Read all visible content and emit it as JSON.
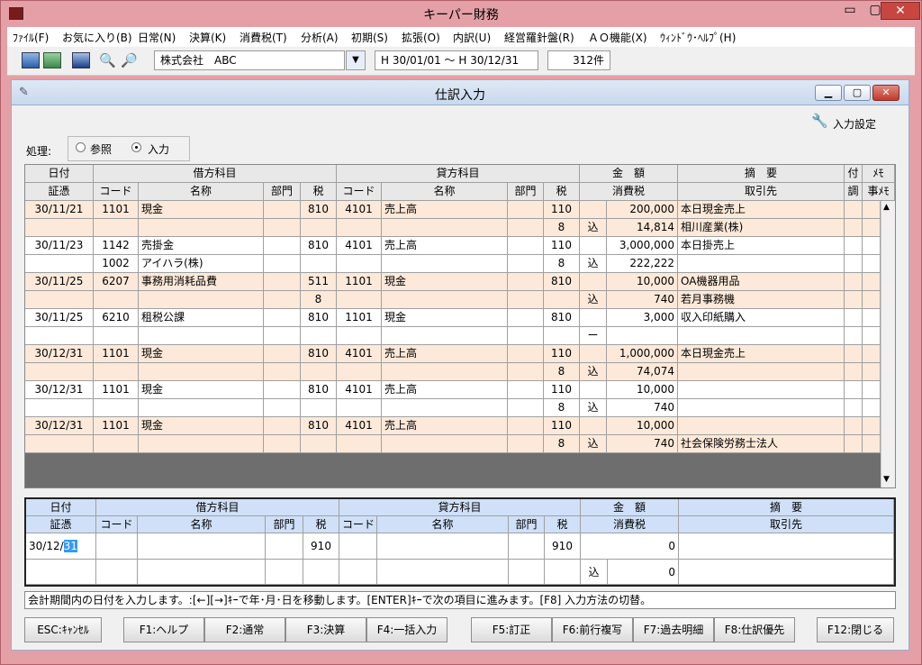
{
  "app": {
    "title": "キーパー財務",
    "minimize": "▭",
    "maximize": "▢",
    "close": "✕"
  },
  "menu": [
    "ﾌｧｲﾙ(F)",
    "お気に入り(B)",
    "日常(N)",
    "決算(K)",
    "消費税(T)",
    "分析(A)",
    "初期(S)",
    "拡張(O)",
    "内訳(U)",
    "経営羅針盤(R)",
    "ＡＯ機能(X)",
    "ｳｨﾝﾄﾞｳ･ﾍﾙﾌﾟ(H)"
  ],
  "toolbar": {
    "company": "株式会社　ABC",
    "period": "H 30/01/01 〜 H 30/12/31",
    "count": "312件"
  },
  "window": {
    "title": "仕訳入力",
    "settings_label": "入力設定"
  },
  "mode": {
    "label": "処理:",
    "ref": "参照",
    "input": "入力"
  },
  "headers": {
    "date": "日付",
    "voucher": "証憑",
    "debit": "借方科目",
    "credit": "貸方科目",
    "code": "コード",
    "name": "名称",
    "dept": "部門",
    "tax": "税",
    "amount": "金　額",
    "ctax": "消費税",
    "desc": "摘　要",
    "partner": "取引先",
    "fu": "付",
    "memo": "ﾒﾓ",
    "chou": "調",
    "jimemo": "事ﾒﾓ"
  },
  "rows": [
    {
      "date": "30/11/21",
      "dcode": "1101",
      "dname": "現金",
      "ddept": "",
      "dtax": "810",
      "ccode": "4101",
      "cname": "売上高",
      "cdept": "",
      "ctax": "110",
      "kom": "",
      "amount": "200,000",
      "desc": "本日現金売上",
      "band": 1
    },
    {
      "date": "",
      "dcode": "",
      "dname": "",
      "ddept": "",
      "dtax": "",
      "ccode": "",
      "cname": "",
      "cdept": "",
      "ctax": "8",
      "kom": "込",
      "amount": "14,814",
      "desc": "相川産業(株)",
      "band": 1
    },
    {
      "date": "30/11/23",
      "dcode": "1142",
      "dname": "売掛金",
      "ddept": "",
      "dtax": "810",
      "ccode": "4101",
      "cname": "売上高",
      "cdept": "",
      "ctax": "110",
      "kom": "",
      "amount": "3,000,000",
      "desc": "本日掛売上",
      "band": 0
    },
    {
      "date": "",
      "dcode": "1002",
      "dname": "アイハラ(株)",
      "ddept": "",
      "dtax": "",
      "ccode": "",
      "cname": "",
      "cdept": "",
      "ctax": "8",
      "kom": "込",
      "amount": "222,222",
      "desc": "",
      "band": 0
    },
    {
      "date": "30/11/25",
      "dcode": "6207",
      "dname": "事務用消耗品費",
      "ddept": "",
      "dtax": "511",
      "ccode": "1101",
      "cname": "現金",
      "cdept": "",
      "ctax": "810",
      "kom": "",
      "amount": "10,000",
      "desc": "OA機器用品",
      "band": 1
    },
    {
      "date": "",
      "dcode": "",
      "dname": "",
      "ddept": "",
      "dtax": "8",
      "ccode": "",
      "cname": "",
      "cdept": "",
      "ctax": "",
      "kom": "込",
      "amount": "740",
      "desc": "若月事務機",
      "band": 1
    },
    {
      "date": "30/11/25",
      "dcode": "6210",
      "dname": "租税公課",
      "ddept": "",
      "dtax": "810",
      "ccode": "1101",
      "cname": "現金",
      "cdept": "",
      "ctax": "810",
      "kom": "",
      "amount": "3,000",
      "desc": "収入印紙購入",
      "band": 0
    },
    {
      "date": "",
      "dcode": "",
      "dname": "",
      "ddept": "",
      "dtax": "",
      "ccode": "",
      "cname": "",
      "cdept": "",
      "ctax": "",
      "kom": "ー",
      "amount": "",
      "desc": "",
      "band": 0
    },
    {
      "date": "30/12/31",
      "dcode": "1101",
      "dname": "現金",
      "ddept": "",
      "dtax": "810",
      "ccode": "4101",
      "cname": "売上高",
      "cdept": "",
      "ctax": "110",
      "kom": "",
      "amount": "1,000,000",
      "desc": "本日現金売上",
      "band": 1
    },
    {
      "date": "",
      "dcode": "",
      "dname": "",
      "ddept": "",
      "dtax": "",
      "ccode": "",
      "cname": "",
      "cdept": "",
      "ctax": "8",
      "kom": "込",
      "amount": "74,074",
      "desc": "",
      "band": 1
    },
    {
      "date": "30/12/31",
      "dcode": "1101",
      "dname": "現金",
      "ddept": "",
      "dtax": "810",
      "ccode": "4101",
      "cname": "売上高",
      "cdept": "",
      "ctax": "110",
      "kom": "",
      "amount": "10,000",
      "desc": "",
      "band": 0
    },
    {
      "date": "",
      "dcode": "",
      "dname": "",
      "ddept": "",
      "dtax": "",
      "ccode": "",
      "cname": "",
      "cdept": "",
      "ctax": "8",
      "kom": "込",
      "amount": "740",
      "desc": "",
      "band": 0
    },
    {
      "date": "30/12/31",
      "dcode": "1101",
      "dname": "現金",
      "ddept": "",
      "dtax": "810",
      "ccode": "4101",
      "cname": "売上高",
      "cdept": "",
      "ctax": "110",
      "kom": "",
      "amount": "10,000",
      "desc": "",
      "band": 1
    },
    {
      "date": "",
      "dcode": "",
      "dname": "",
      "ddept": "",
      "dtax": "",
      "ccode": "",
      "cname": "",
      "cdept": "",
      "ctax": "8",
      "kom": "込",
      "amount": "740",
      "desc": "社会保険労務士法人",
      "band": 1
    }
  ],
  "entry": {
    "date_prefix": "30/12/",
    "date_sel": "31",
    "dtax": "910",
    "ctax": "910",
    "amount": "0",
    "kom": "込",
    "tax_amount": "0"
  },
  "status": "会計期間内の日付を入力します。:[←][→]ｷｰで年･月･日を移動します。[ENTER]ｷｰで次の項目に進みます。[F8] 入力方法の切替。",
  "fkeys": [
    "ESC:ｷｬﾝｾﾙ",
    "F1:ヘルプ",
    "F2:通常",
    "F3:決算",
    "F4:一括入力",
    "F5:訂正",
    "F6:前行複写",
    "F7:過去明細",
    "F8:仕訳優先",
    "F12:閉じる"
  ],
  "colors": {
    "band": "#fde9d9",
    "header_blue": "#cfe0f8",
    "accent": "#3399ff"
  }
}
